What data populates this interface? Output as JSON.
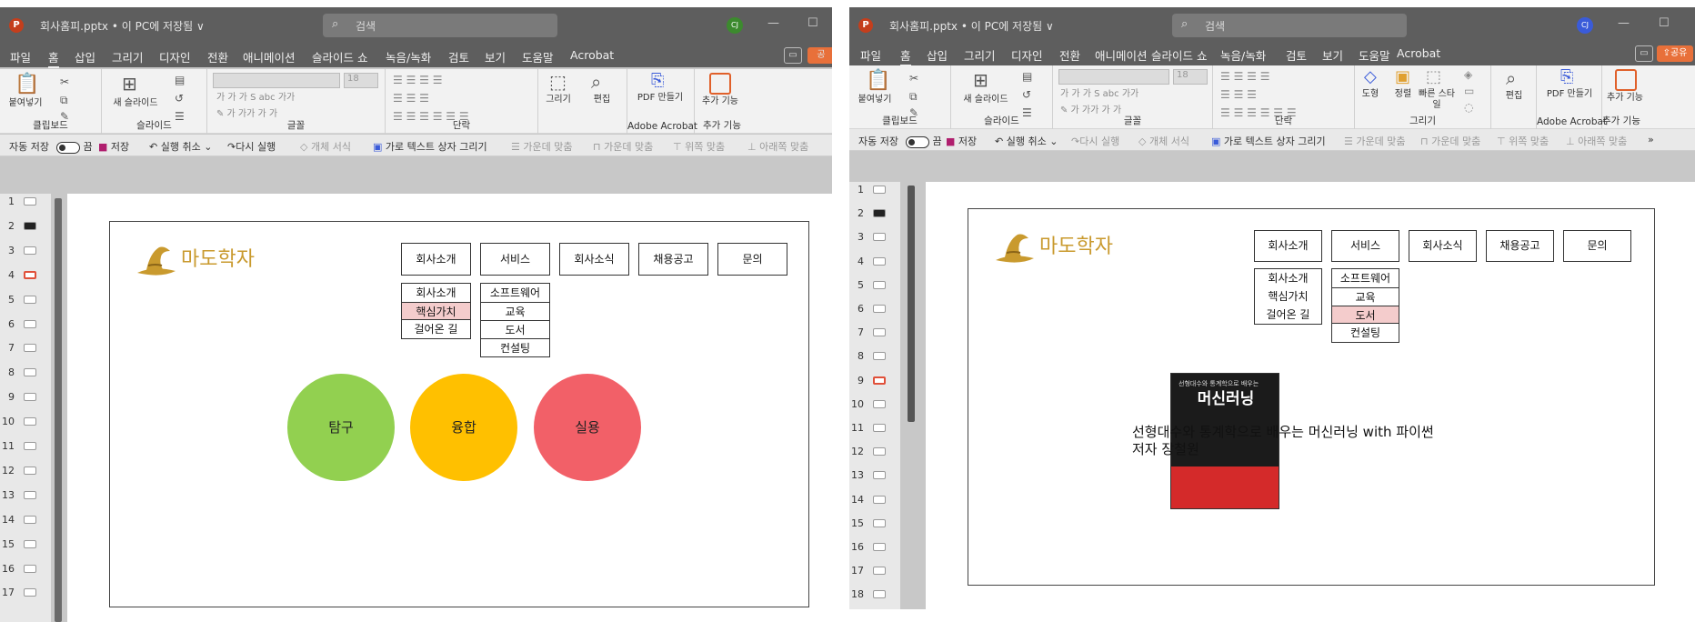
{
  "left": {
    "title": "회사홈피.pptx • 이 PC에 저장됨 ∨",
    "search_placeholder": "검색",
    "avatar": "CJ",
    "avatar_color": "#3c8a2e",
    "tabs": [
      "파일",
      "홈",
      "삽입",
      "그리기",
      "디자인",
      "전환",
      "애니메이션",
      "슬라이드 쇼",
      "녹음/녹화",
      "검토",
      "보기",
      "도움말",
      "Acrobat"
    ],
    "share_label": "공",
    "ribbon": {
      "paste": "붙여넣기",
      "clipboard": "클립보드",
      "new_slide": "새 슬라이드",
      "slides": "슬라이드",
      "font": "글꼴",
      "paragraph": "단락",
      "draw": "그리기",
      "edit": "편집",
      "pdf": "PDF 만들기",
      "adobe": "Adobe Acrobat",
      "addins": "추가 기능",
      "addins_group": "추가 기능",
      "font_size": "18"
    },
    "qat": {
      "autosave": "자동 저장",
      "toggle": "끔",
      "save": "저장",
      "undo": "실행 취소",
      "redo": "다시 실행",
      "format": "개체 서식",
      "textbox": "가로 텍스트 상자 그리기",
      "center": "가운데 맞춤",
      "center2": "가운데 맞춤",
      "top": "위쪽 맞춤",
      "bottom": "아래쪽 맞춤"
    },
    "slides": [
      "1",
      "2",
      "3",
      "4",
      "5",
      "6",
      "7",
      "8",
      "9",
      "10",
      "11",
      "12",
      "13",
      "14",
      "15",
      "16",
      "17"
    ],
    "selected_slide": "4",
    "slide": {
      "logo": "마도학자",
      "nav": [
        "회사소개",
        "서비스",
        "회사소식",
        "채용공고",
        "문의"
      ],
      "sub1": [
        "회사소개",
        "핵심가치",
        "걸어온 길"
      ],
      "sub2": [
        "소프트웨어",
        "교육",
        "도서",
        "컨설팅"
      ],
      "circles": [
        {
          "label": "탐구",
          "color": "#92d050"
        },
        {
          "label": "융합",
          "color": "#ffc000"
        },
        {
          "label": "실용",
          "color": "#f26068"
        }
      ]
    }
  },
  "right": {
    "title": "회사홈피.pptx • 이 PC에 저장됨 ∨",
    "search_placeholder": "검색",
    "avatar": "CJ",
    "avatar_color": "#3a5bd9",
    "tabs": [
      "파일",
      "홈",
      "삽입",
      "그리기",
      "디자인",
      "전환",
      "애니메이션",
      "슬라이드 쇼",
      "녹음/녹화",
      "검토",
      "보기",
      "도움말",
      "Acrobat"
    ],
    "share_label": "공유",
    "ribbon": {
      "paste": "붙여넣기",
      "clipboard": "클립보드",
      "new_slide": "새 슬라이드",
      "slides": "슬라이드",
      "font": "글꼴",
      "paragraph": "단락",
      "shape": "도형",
      "arrange": "정렬",
      "quick_style": "빠른 스타일",
      "draw": "그리기",
      "edit": "편집",
      "pdf": "PDF 만들기",
      "adobe": "Adobe Acrobat",
      "addins": "추가 기능",
      "addins_group": "추가 기능",
      "font_size": "18"
    },
    "qat": {
      "autosave": "자동 저장",
      "toggle": "끔",
      "save": "저장",
      "undo": "실행 취소",
      "redo": "다시 실행",
      "format": "개체 서식",
      "textbox": "가로 텍스트 상자 그리기",
      "center": "가운데 맞춤",
      "center2": "가운데 맞춤",
      "top": "위쪽 맞춤",
      "bottom": "아래쪽 맞춤",
      "more": "»"
    },
    "slides": [
      "1",
      "2",
      "3",
      "4",
      "5",
      "6",
      "7",
      "8",
      "9",
      "10",
      "11",
      "12",
      "13",
      "14",
      "15",
      "16",
      "17",
      "18"
    ],
    "selected_slide": "9",
    "slide": {
      "logo": "마도학자",
      "nav": [
        "회사소개",
        "서비스",
        "회사소식",
        "채용공고",
        "문의"
      ],
      "sub1": [
        "회사소개",
        "핵심가치",
        "걸어온 길"
      ],
      "sub2": [
        "소프트웨어",
        "교육",
        "도서",
        "컨설팅"
      ],
      "book_cover_title": "머신러닝",
      "book_cover_top": "선형대수와 통계학으로 배우는",
      "book_line1": "선형대수와 통계학으로 배우는 머신러닝 with 파이썬",
      "book_line2": "저자 장철원"
    }
  }
}
